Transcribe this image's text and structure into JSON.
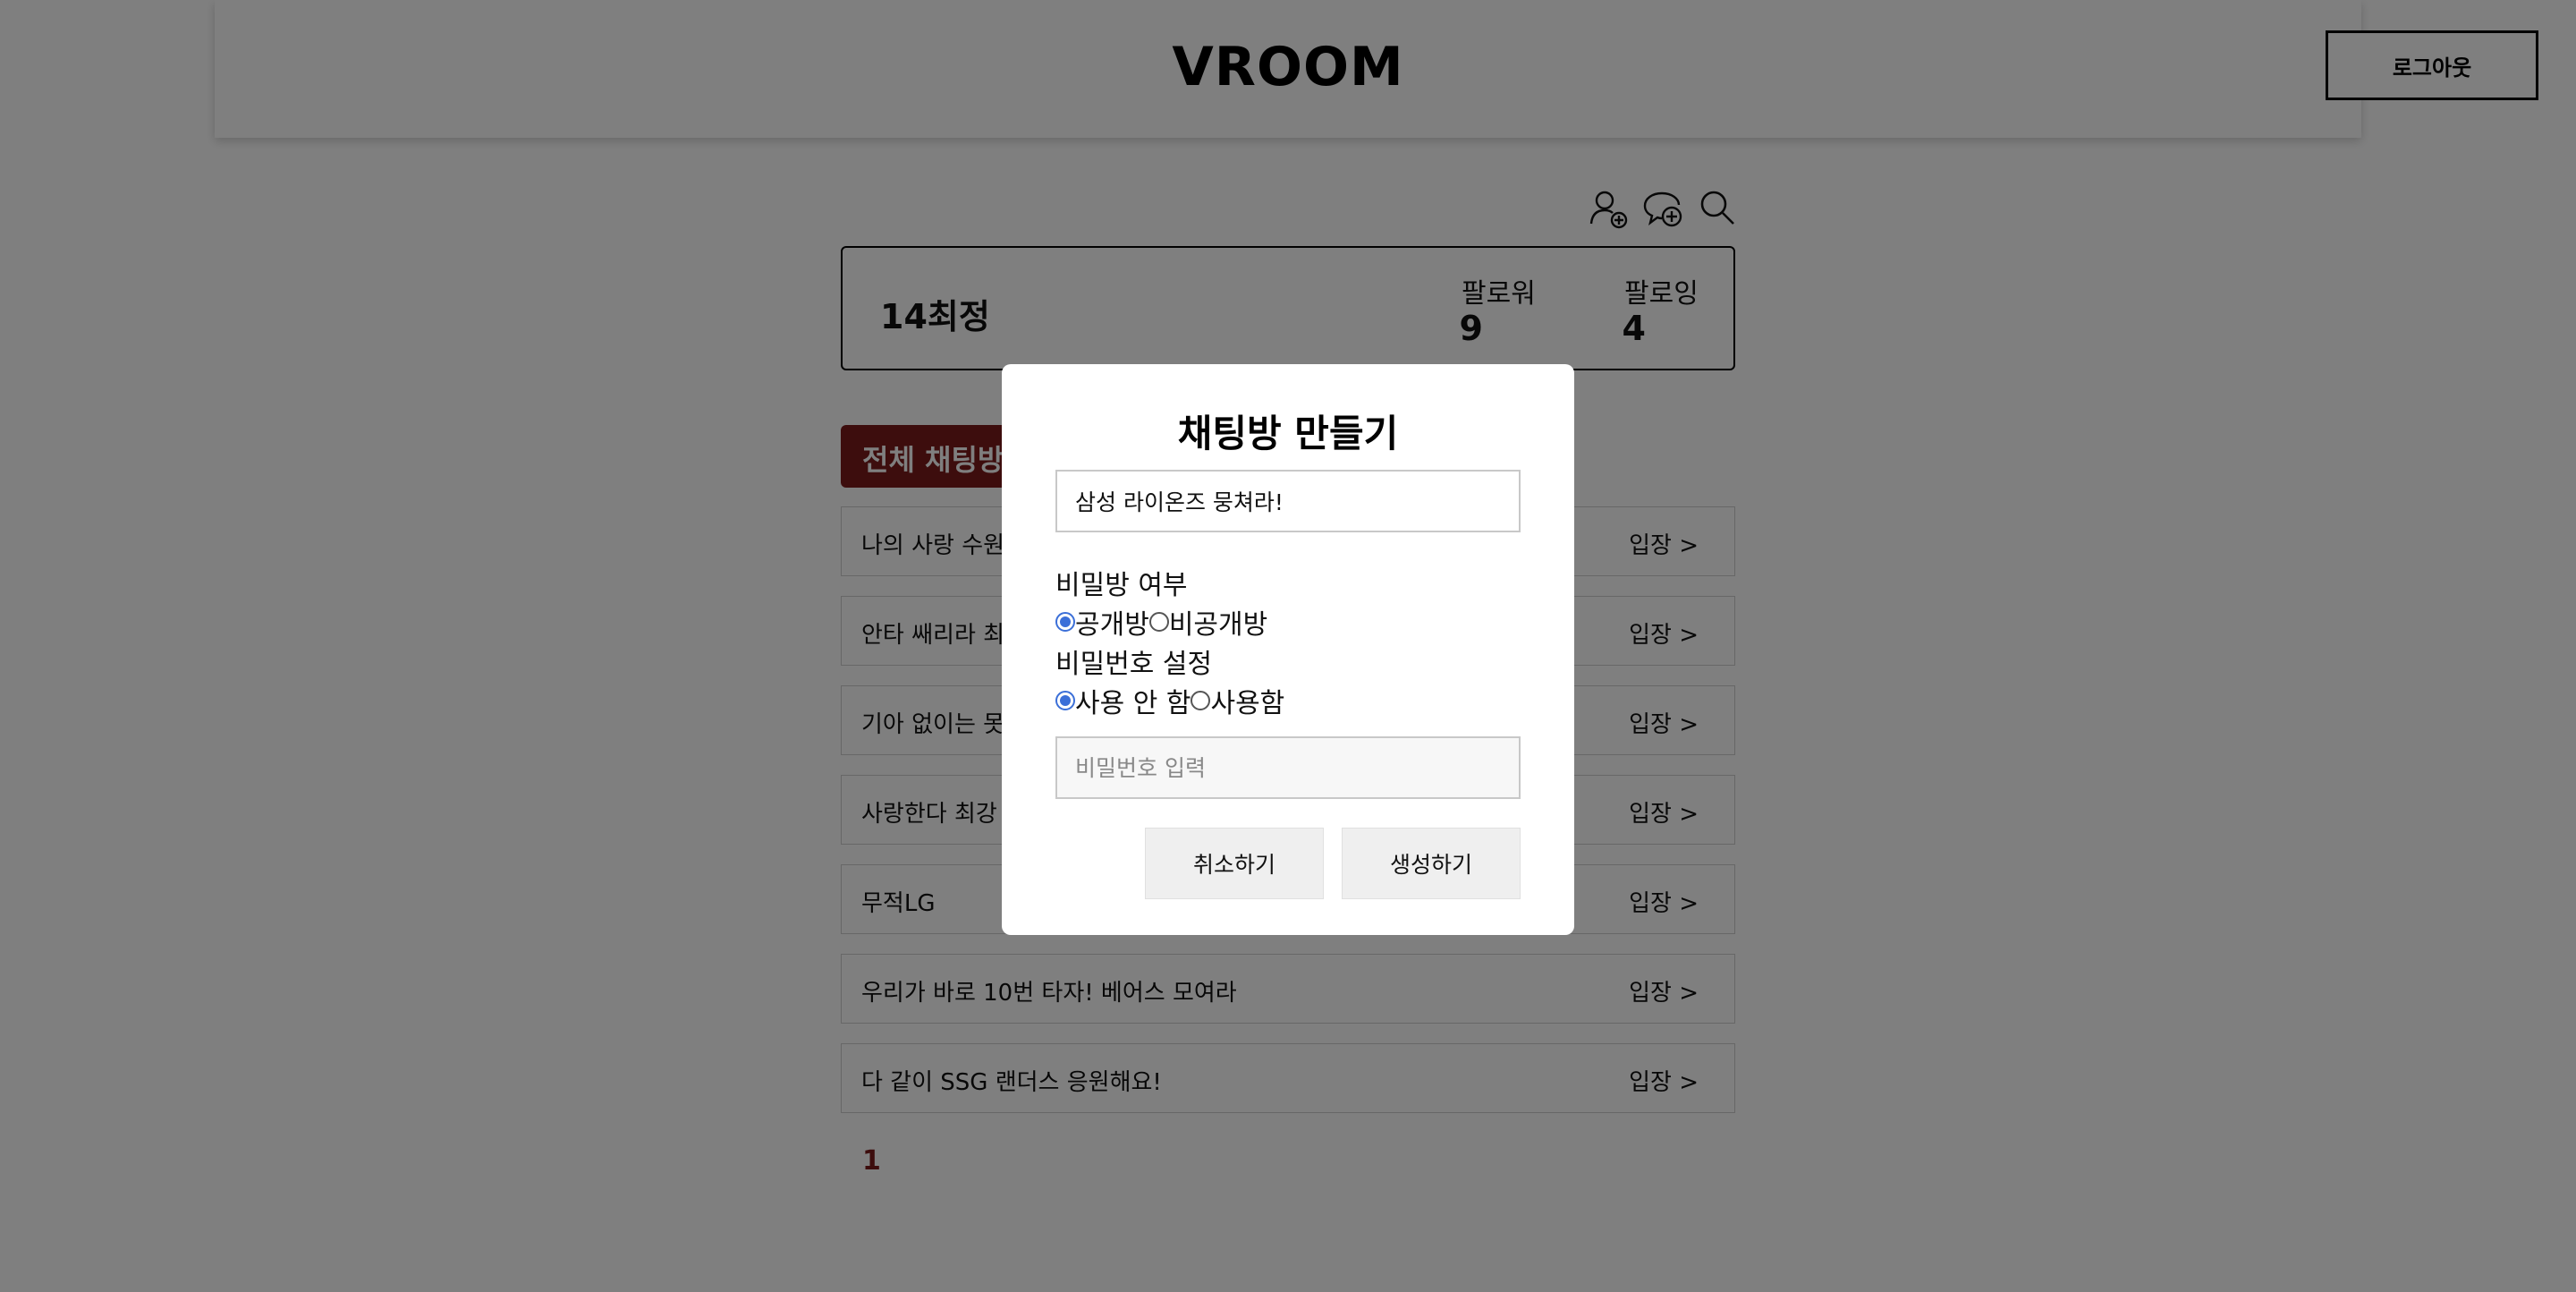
{
  "header": {
    "logo": "VROOM",
    "logout_label": "로그아웃"
  },
  "toolbar_icons": [
    "add-friend-icon",
    "add-chat-icon",
    "search-icon"
  ],
  "profile": {
    "name": "14최정",
    "followers_label": "팔로워",
    "followers_count": "9",
    "following_label": "팔로잉",
    "following_count": "4"
  },
  "rooms_section": {
    "title": "전체 채팅방",
    "enter_label": "입장 >",
    "rooms": [
      {
        "name": "나의 사랑 수원"
      },
      {
        "name": "안타 쌔리라 최"
      },
      {
        "name": "기아 없이는 못"
      },
      {
        "name": "사랑한다 최강"
      },
      {
        "name": "무적LG"
      },
      {
        "name": "우리가 바로 10번 타자! 베어스 모여라"
      },
      {
        "name": "다 같이 SSG 랜더스 응원해요!"
      }
    ]
  },
  "pagination": {
    "current_page": "1"
  },
  "modal": {
    "title": "채팅방 만들기",
    "room_name_value": "삼성 라이온즈 뭉쳐라!",
    "secret_label": "비밀방 여부",
    "secret_options": {
      "public": "공개방",
      "private": "비공개방",
      "selected": "public"
    },
    "password_label": "비밀번호 설정",
    "password_options": {
      "off": "사용 안 함",
      "on": "사용함",
      "selected": "off"
    },
    "password_placeholder": "비밀번호 입력",
    "cancel_label": "취소하기",
    "create_label": "생성하기"
  },
  "colors": {
    "accent": "#7a1a1a",
    "radio": "#3b6fd8",
    "overlay": "rgba(0,0,0,0.5)"
  }
}
